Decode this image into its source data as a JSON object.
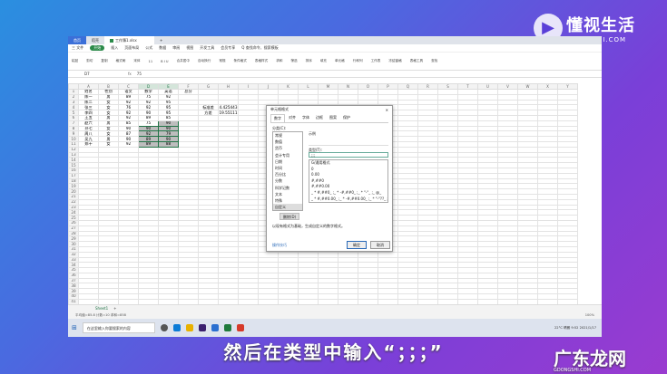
{
  "logo": {
    "title": "懂视生活",
    "url_text": "IDONGSHI.COM"
  },
  "tabs": {
    "home": "首页",
    "templates": "稻壳",
    "file": "工作簿1.xlsx"
  },
  "menu": [
    "三 文件",
    "开始",
    "插入",
    "页面布局",
    "公式",
    "数据",
    "审阅",
    "视图",
    "开发工具",
    "会员专享",
    "Q 查找命令、搜索模板"
  ],
  "ribbon": [
    "粘贴",
    "剪切",
    "复制",
    "格式刷",
    "宋体",
    "11",
    "B I U",
    "合并居中",
    "自动换行",
    "常规",
    "条件格式",
    "表格样式",
    "求和",
    "筛选",
    "排序",
    "填充",
    "单元格",
    "行和列",
    "工作表",
    "冻结窗格",
    "表格工具",
    "查找"
  ],
  "formula_bar": {
    "cell": "D7",
    "fx": "fx",
    "value": "75"
  },
  "columns": [
    "A",
    "B",
    "C",
    "D",
    "E",
    "F",
    "G",
    "H",
    "I",
    "J",
    "K",
    "L",
    "M",
    "N",
    "O",
    "P",
    "Q",
    "R",
    "S",
    "T",
    "U",
    "V",
    "W",
    "X",
    "Y"
  ],
  "selected_columns": [
    "D",
    "E"
  ],
  "rows": [
    [
      "姓名",
      "性别",
      "语文",
      "数学",
      "英语",
      "总分",
      "",
      "",
      ""
    ],
    [
      "陈一",
      "男",
      "89",
      "75",
      "92",
      "",
      "",
      "",
      ""
    ],
    [
      "陈二",
      "女",
      "92",
      "92",
      "95",
      "",
      "",
      "",
      ""
    ],
    [
      "张三",
      "女",
      "76",
      "92",
      "95",
      "",
      "标准差",
      "4.425443",
      ""
    ],
    [
      "李四",
      "女",
      "92",
      "90",
      "95",
      "",
      "方差",
      "19.55111",
      ""
    ],
    [
      "王五",
      "男",
      "92",
      "89",
      "85",
      "",
      "",
      "",
      ""
    ],
    [
      "赵六",
      "男",
      "85",
      "75",
      "90",
      "",
      "",
      "",
      ""
    ],
    [
      "孙七",
      "女",
      "90",
      "90",
      "90",
      "",
      "",
      "",
      ""
    ],
    [
      "周八",
      "女",
      "87",
      "92",
      "79",
      "",
      "",
      "",
      ""
    ],
    [
      "吴九",
      "男",
      "90",
      "89",
      "90",
      "",
      "",
      "",
      ""
    ],
    [
      "郑十",
      "女",
      "92",
      "89",
      "88",
      "",
      "",
      "",
      ""
    ]
  ],
  "sheet_tab": "Sheet1",
  "status": {
    "left": "平均值=85.8  计数=10  求和=858",
    "zoom": "100%"
  },
  "dialog": {
    "title": "单元格格式",
    "tabs": [
      "数字",
      "对齐",
      "字体",
      "边框",
      "图案",
      "保护"
    ],
    "category_label": "分类(C):",
    "categories": [
      "常规",
      "数值",
      "货币",
      "会计专用",
      "日期",
      "时间",
      "百分比",
      "分数",
      "科学记数",
      "文本",
      "特殊",
      "自定义"
    ],
    "selected_category": "自定义",
    "sample_label": "示例",
    "type_label": "类型(T):",
    "type_value": ";;;",
    "type_list": [
      "G/通用格式",
      "0",
      "0.00",
      "#,##0",
      "#,##0.00",
      "_ * #,##0_ ;_ * -#,##0_ ;_ * \"-\"_ ;_ @_",
      "_ * #,##0.00_ ;_ * -#,##0.00_ ;_ * \"-\"??_ ;_ @_"
    ],
    "delete_label": "删除(D)",
    "description": "以现有格式为基础，生成自定义的数字格式。",
    "tips": "操作技巧",
    "ok": "确定",
    "cancel": "取消"
  },
  "taskbar": {
    "search": "在这里输入你要搜索的内容",
    "tray": "22°C 晴朗  9:52  2021/1/17"
  },
  "subtitle": "然后在类型中输入“；；；”",
  "watermark": {
    "title": "广东龙网",
    "url_text": "GDONGSHI.COM"
  }
}
